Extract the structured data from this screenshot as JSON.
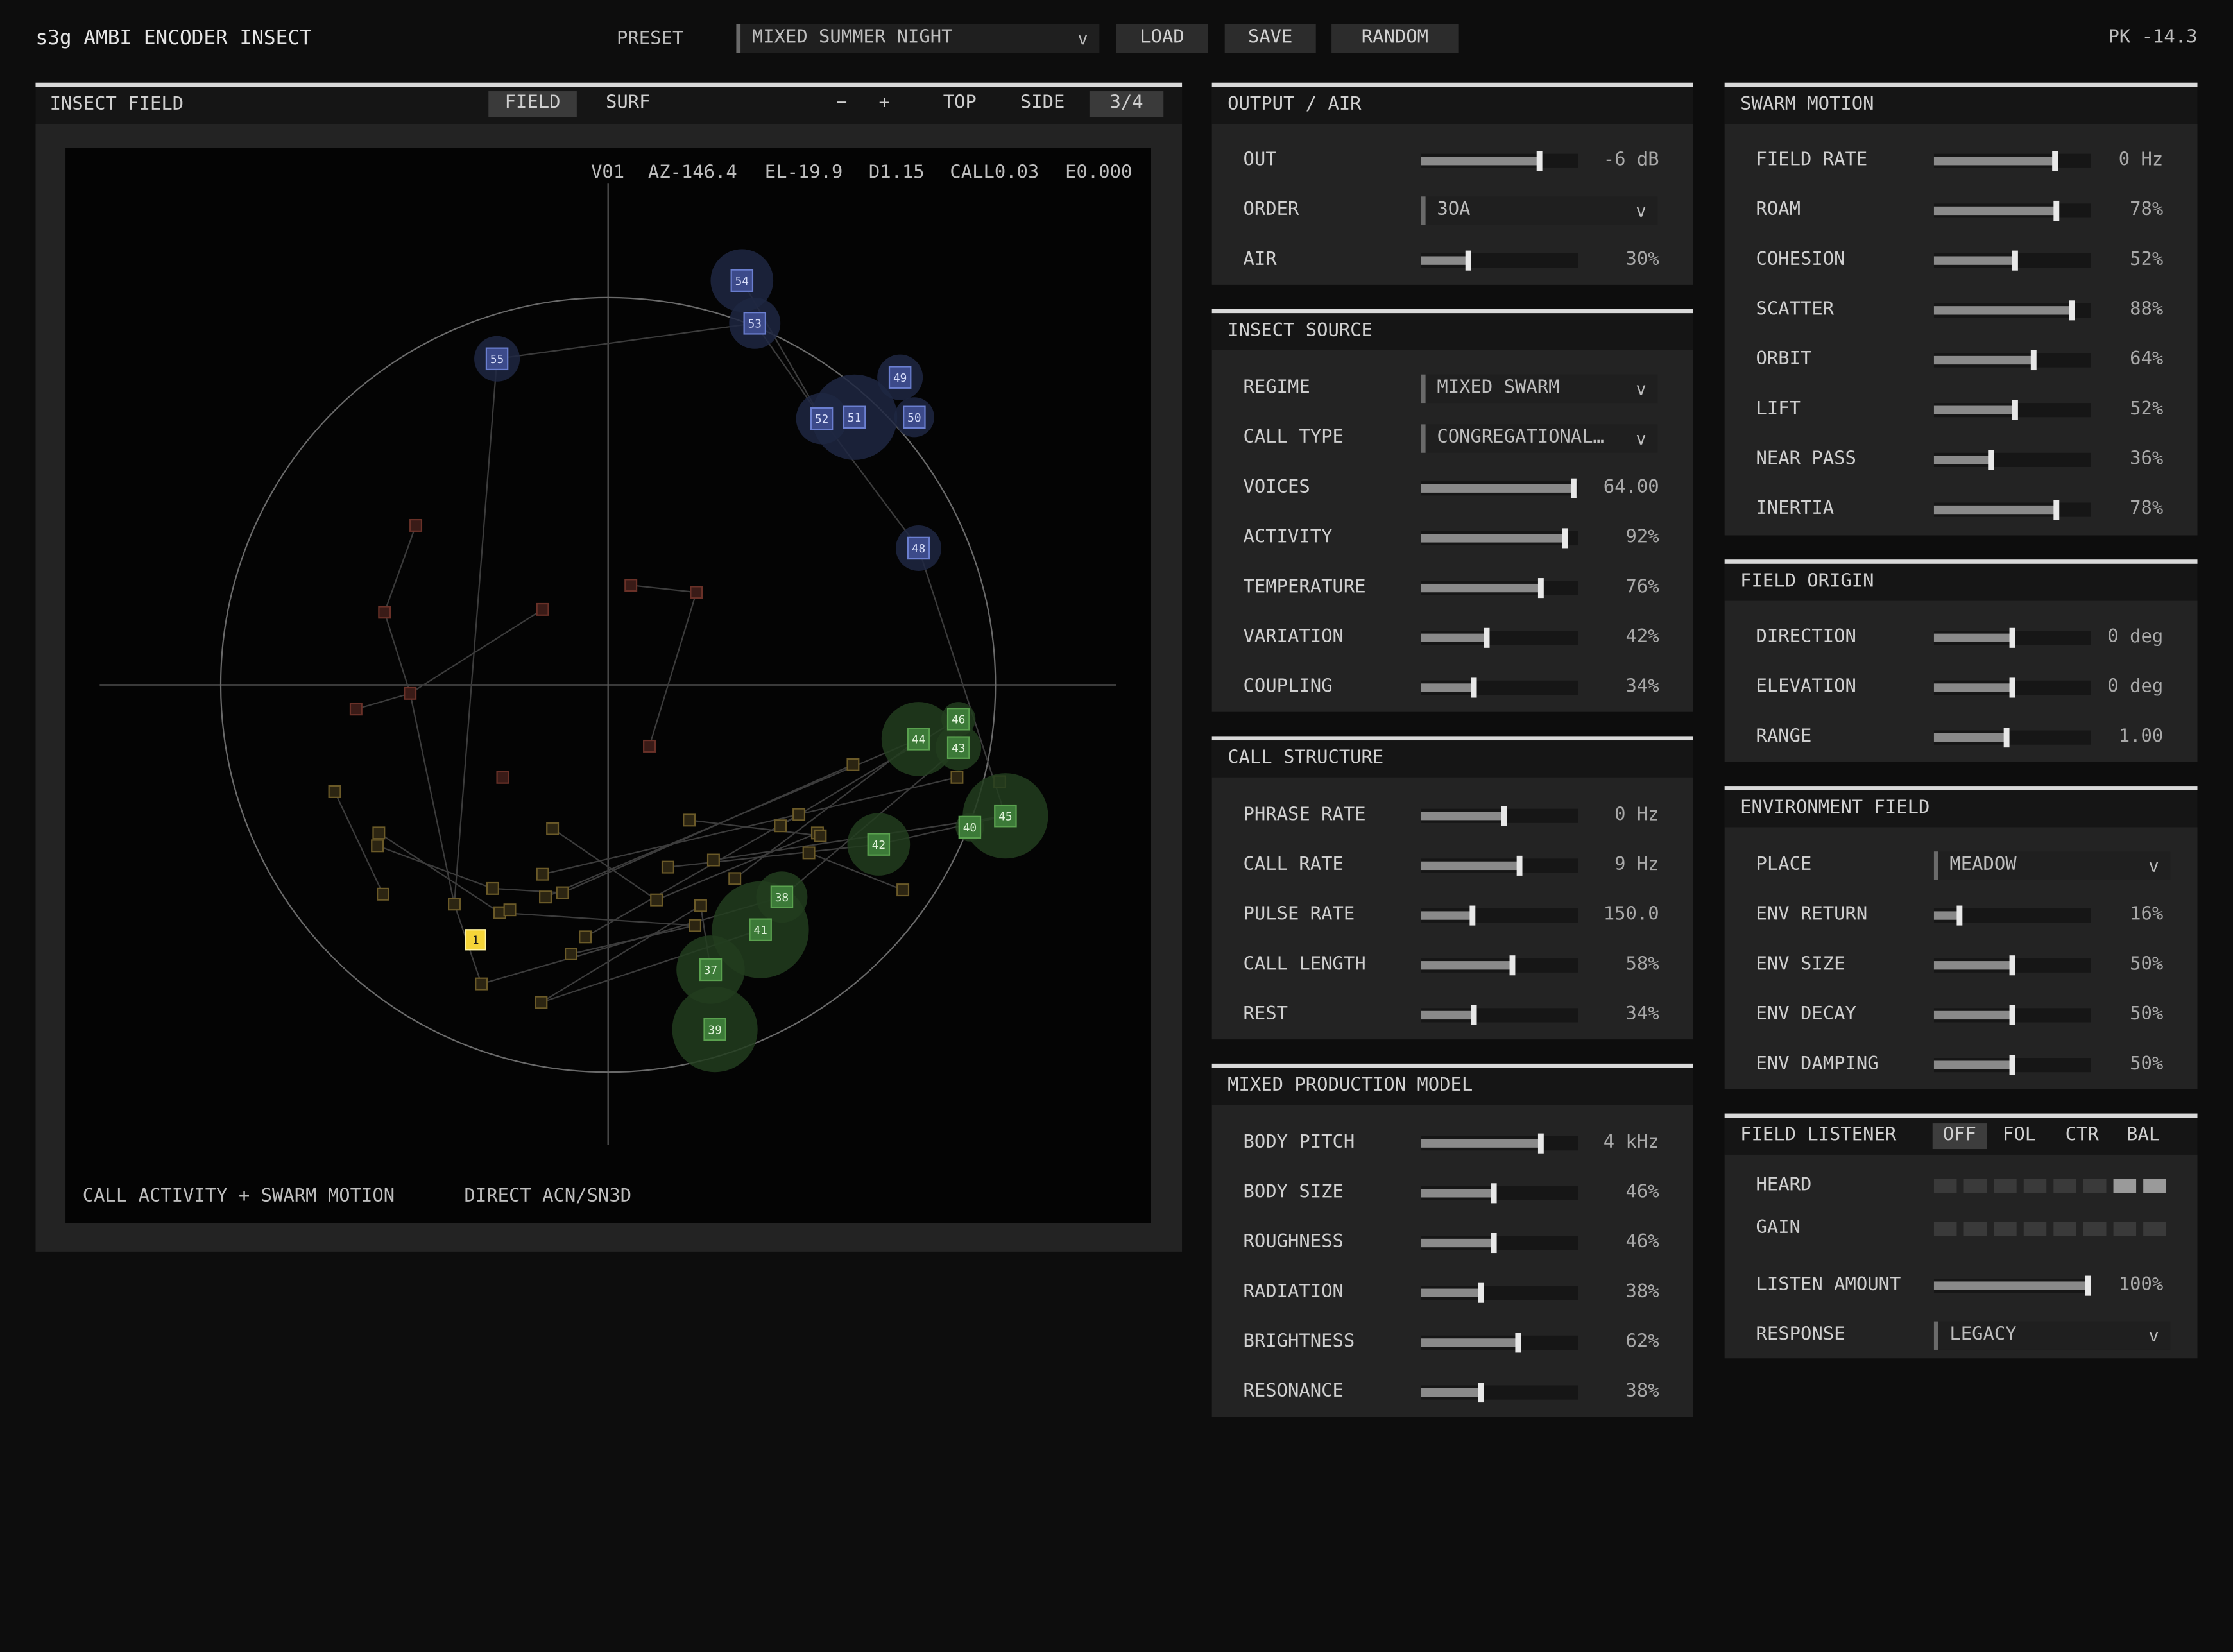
{
  "app": {
    "title": "s3g AMBI ENCODER INSECT",
    "peak": "PK -14.3"
  },
  "topbar": {
    "preset_label": "PRESET",
    "preset_value": "MIXED SUMMER NIGHT",
    "load": "LOAD",
    "save": "SAVE",
    "random": "RANDOM"
  },
  "field": {
    "title": "INSECT FIELD",
    "modes": [
      "FIELD",
      "SURF"
    ],
    "active_mode": "FIELD",
    "zoom_minus": "−",
    "zoom_plus": "+",
    "views": [
      "TOP",
      "SIDE",
      "3/4"
    ],
    "active_view": "3/4",
    "readout": [
      "V01",
      "AZ-146.4",
      "EL-19.9",
      "D1.15",
      "CALL0.03",
      "E0.000"
    ],
    "footer_left": "CALL ACTIVITY + SWARM MOTION",
    "footer_right": "DIRECT ACN/SN3D",
    "colors": {
      "blue": "#6b7fd0",
      "green": "#5aa14f",
      "olive": "#6b5a28",
      "brown": "#6a3128",
      "selected": "#f5d538"
    },
    "nodes_blue": [
      "54",
      "53",
      "55",
      "49",
      "52",
      "51",
      "50",
      "48"
    ],
    "nodes_green": [
      "44",
      "46",
      "43",
      "45",
      "42",
      "40",
      "38",
      "41",
      "37",
      "39"
    ],
    "selected_node": "1"
  },
  "output_air": {
    "title": "OUTPUT / AIR",
    "rows": [
      {
        "label": "OUT",
        "value": "-6 dB",
        "level": 0.75
      },
      {
        "label": "ORDER",
        "select": "3OA"
      },
      {
        "label": "AIR",
        "value": "30%",
        "level": 0.3
      }
    ]
  },
  "insect_source": {
    "title": "INSECT SOURCE",
    "rows": [
      {
        "label": "REGIME",
        "select": "MIXED SWARM"
      },
      {
        "label": "CALL TYPE",
        "select": "CONGREGATIONAL…"
      },
      {
        "label": "VOICES",
        "value": "64.00",
        "level": 0.97
      },
      {
        "label": "ACTIVITY",
        "value": "92%",
        "level": 0.92
      },
      {
        "label": "TEMPERATURE",
        "value": "76%",
        "level": 0.76
      },
      {
        "label": "VARIATION",
        "value": "42%",
        "level": 0.42
      },
      {
        "label": "COUPLING",
        "value": "34%",
        "level": 0.34
      }
    ]
  },
  "call_structure": {
    "title": "CALL STRUCTURE",
    "rows": [
      {
        "label": "PHRASE RATE",
        "value": "0 Hz",
        "level": 0.53
      },
      {
        "label": "CALL RATE",
        "value": "9 Hz",
        "level": 0.63
      },
      {
        "label": "PULSE RATE",
        "value": "150.0",
        "level": 0.33
      },
      {
        "label": "CALL LENGTH",
        "value": "58%",
        "level": 0.58
      },
      {
        "label": "REST",
        "value": "34%",
        "level": 0.34
      }
    ]
  },
  "mixed_production": {
    "title": "MIXED PRODUCTION MODEL",
    "rows": [
      {
        "label": "BODY PITCH",
        "value": "4 kHz",
        "level": 0.76
      },
      {
        "label": "BODY SIZE",
        "value": "46%",
        "level": 0.46
      },
      {
        "label": "ROUGHNESS",
        "value": "46%",
        "level": 0.46
      },
      {
        "label": "RADIATION",
        "value": "38%",
        "level": 0.38
      },
      {
        "label": "BRIGHTNESS",
        "value": "62%",
        "level": 0.62
      },
      {
        "label": "RESONANCE",
        "value": "38%",
        "level": 0.38
      }
    ]
  },
  "swarm_motion": {
    "title": "SWARM MOTION",
    "rows": [
      {
        "label": "FIELD RATE",
        "value": "0 Hz",
        "level": 0.77
      },
      {
        "label": "ROAM",
        "value": "78%",
        "level": 0.78
      },
      {
        "label": "COHESION",
        "value": "52%",
        "level": 0.52
      },
      {
        "label": "SCATTER",
        "value": "88%",
        "level": 0.88
      },
      {
        "label": "ORBIT",
        "value": "64%",
        "level": 0.64
      },
      {
        "label": "LIFT",
        "value": "52%",
        "level": 0.52
      },
      {
        "label": "NEAR PASS",
        "value": "36%",
        "level": 0.36
      },
      {
        "label": "INERTIA",
        "value": "78%",
        "level": 0.78
      }
    ]
  },
  "field_origin": {
    "title": "FIELD ORIGIN",
    "rows": [
      {
        "label": "DIRECTION",
        "value": "0 deg",
        "level": 0.5
      },
      {
        "label": "ELEVATION",
        "value": "0 deg",
        "level": 0.5
      },
      {
        "label": "RANGE",
        "value": "1.00",
        "level": 0.46
      }
    ]
  },
  "environment_field": {
    "title": "ENVIRONMENT FIELD",
    "rows": [
      {
        "label": "PLACE",
        "select": "MEADOW"
      },
      {
        "label": "ENV RETURN",
        "value": "16%",
        "level": 0.16
      },
      {
        "label": "ENV SIZE",
        "value": "50%",
        "level": 0.5
      },
      {
        "label": "ENV DECAY",
        "value": "50%",
        "level": 0.5
      },
      {
        "label": "ENV DAMPING",
        "value": "50%",
        "level": 0.5
      }
    ]
  },
  "field_listener": {
    "title": "FIELD LISTENER",
    "modes": [
      "OFF",
      "FOL",
      "CTR",
      "BAL"
    ],
    "active_mode": "OFF",
    "heard_label": "HEARD",
    "gain_label": "GAIN",
    "listen_amount": {
      "label": "LISTEN AMOUNT",
      "value": "100%",
      "level": 1.0
    },
    "response": {
      "label": "RESPONSE",
      "select": "LEGACY"
    }
  }
}
